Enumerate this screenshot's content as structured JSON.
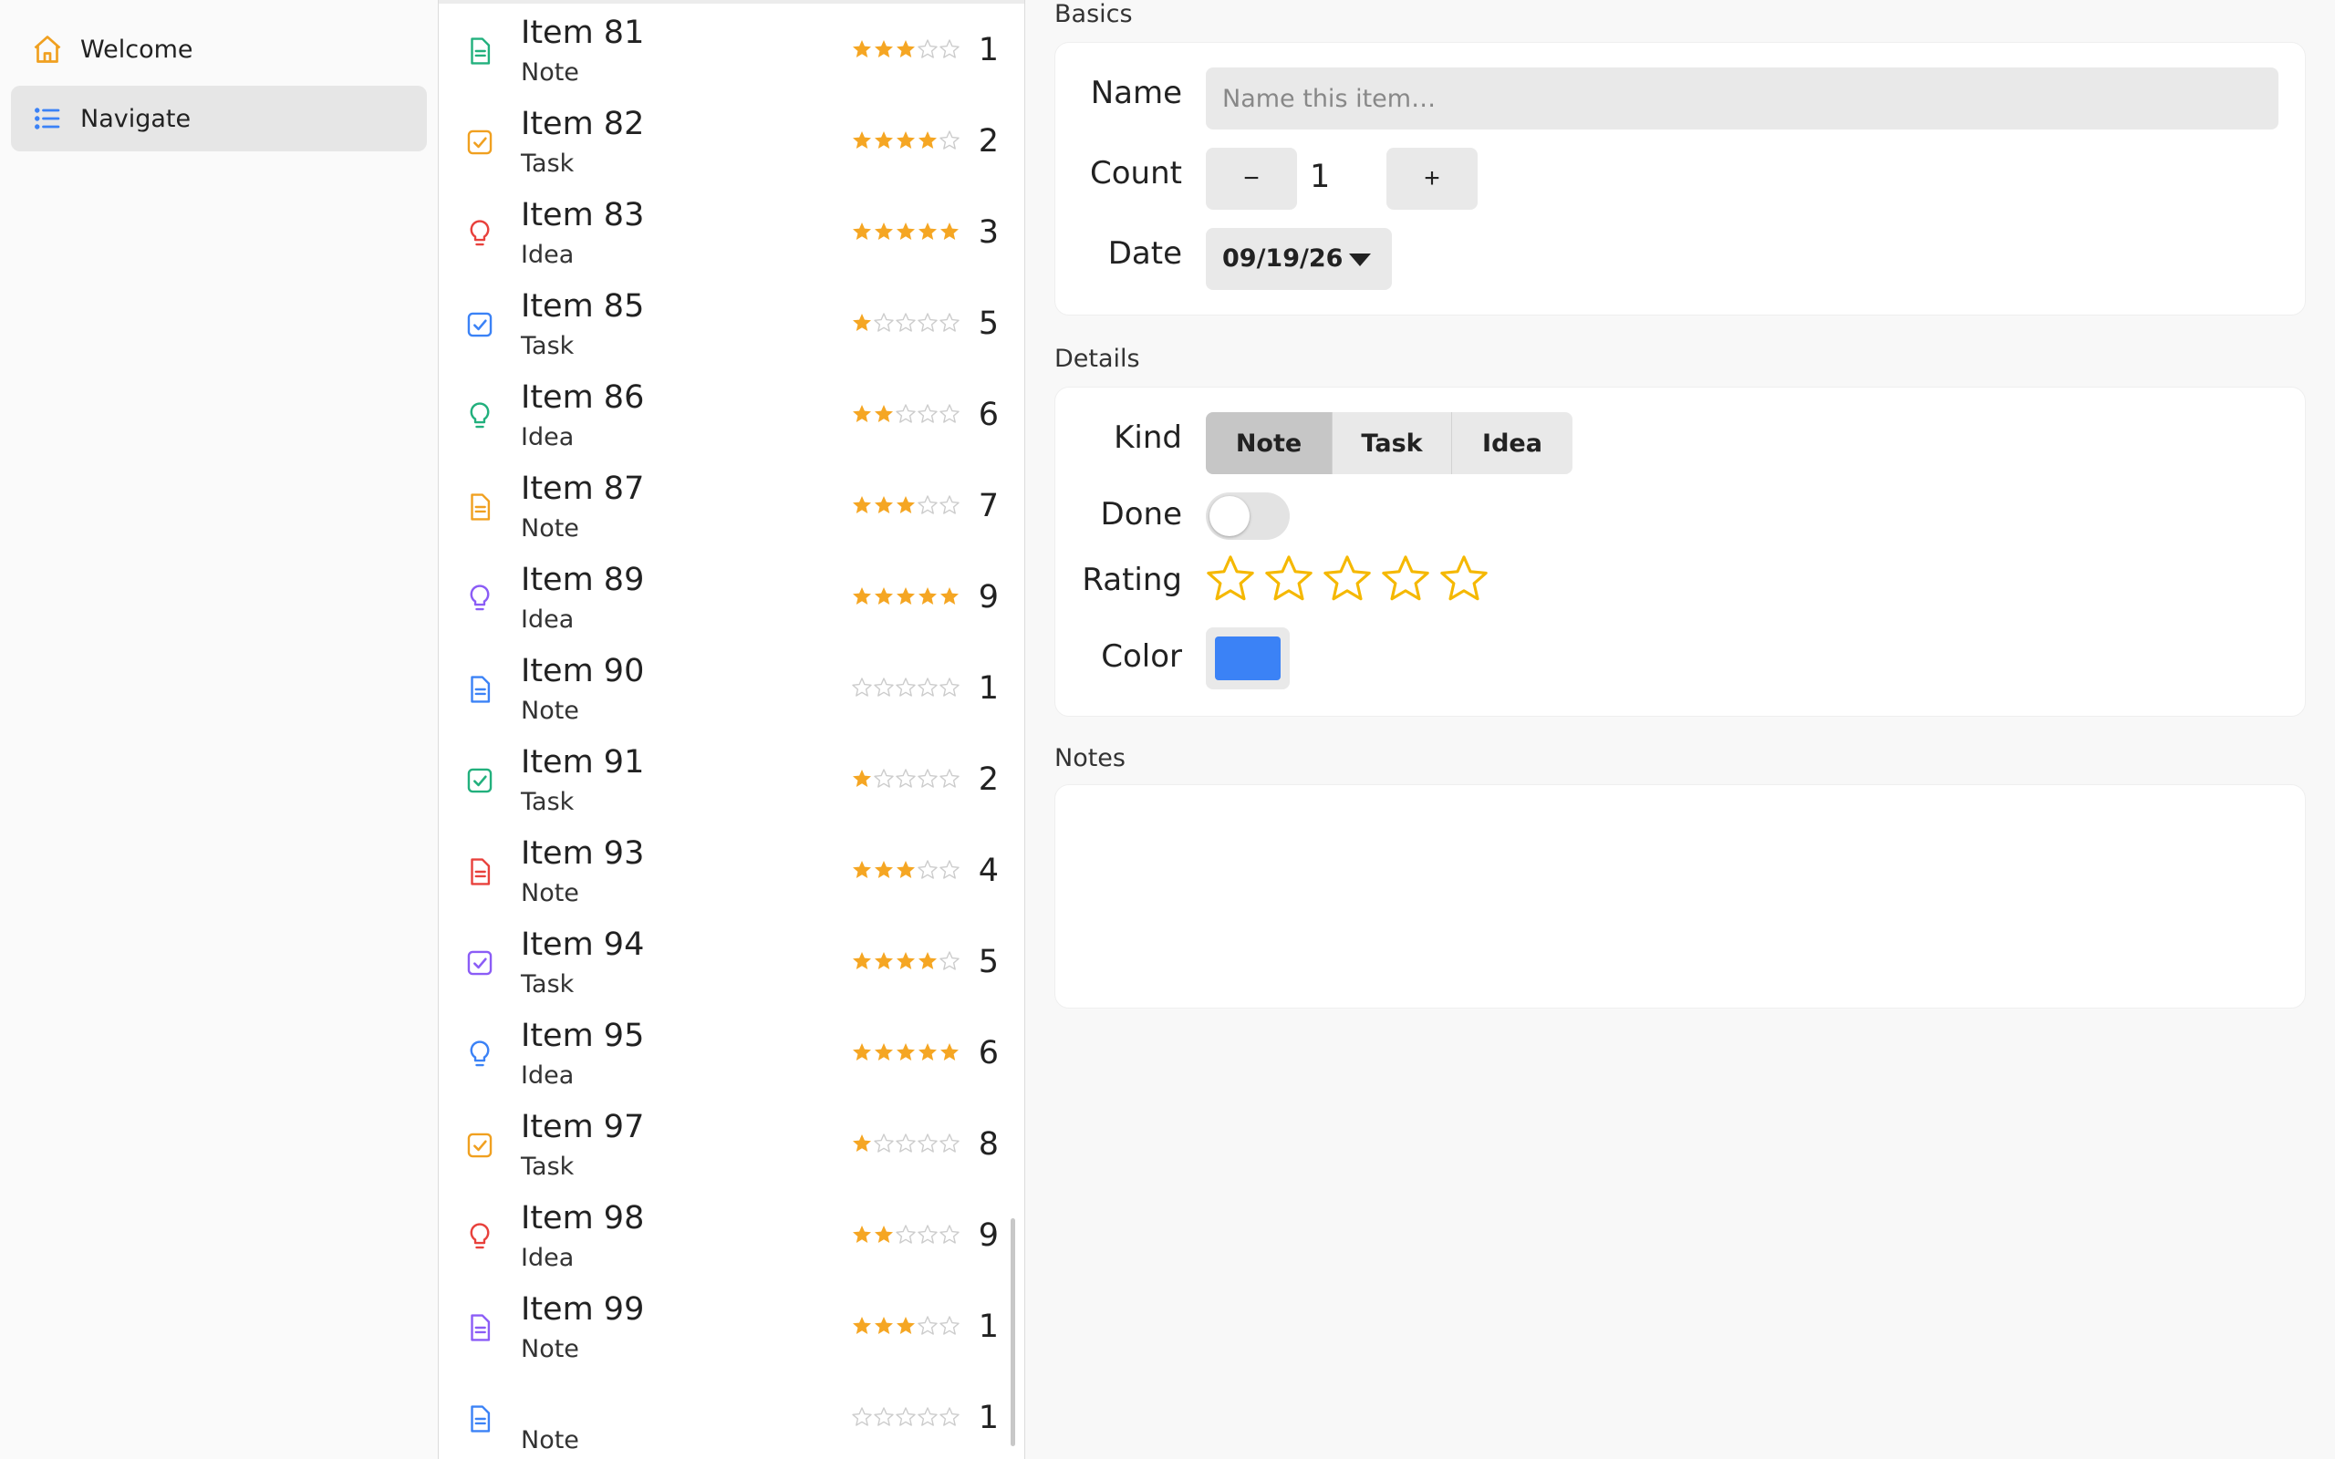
{
  "sidebar": {
    "items": [
      {
        "label": "Welcome",
        "icon": "home-icon",
        "active": false
      },
      {
        "label": "Navigate",
        "icon": "list-icon",
        "active": true
      }
    ]
  },
  "list": {
    "rows": [
      {
        "title": "Item 81",
        "kind": "Note",
        "icon": "note-icon",
        "color": "#22b07d",
        "rating": 3,
        "count": "1"
      },
      {
        "title": "Item 82",
        "kind": "Task",
        "icon": "task-icon",
        "color": "#f0a020",
        "rating": 4,
        "count": "2"
      },
      {
        "title": "Item 83",
        "kind": "Idea",
        "icon": "idea-icon",
        "color": "#e8413c",
        "rating": 5,
        "count": "3"
      },
      {
        "title": "Item 85",
        "kind": "Task",
        "icon": "task-icon",
        "color": "#3b82f6",
        "rating": 1,
        "count": "5"
      },
      {
        "title": "Item 86",
        "kind": "Idea",
        "icon": "idea-icon",
        "color": "#22b07d",
        "rating": 2,
        "count": "6"
      },
      {
        "title": "Item 87",
        "kind": "Note",
        "icon": "note-icon",
        "color": "#f0a020",
        "rating": 3,
        "count": "7"
      },
      {
        "title": "Item 89",
        "kind": "Idea",
        "icon": "idea-icon",
        "color": "#8b5cf6",
        "rating": 5,
        "count": "9"
      },
      {
        "title": "Item 90",
        "kind": "Note",
        "icon": "note-icon",
        "color": "#3b82f6",
        "rating": 0,
        "count": "1"
      },
      {
        "title": "Item 91",
        "kind": "Task",
        "icon": "task-icon",
        "color": "#22b07d",
        "rating": 1,
        "count": "2"
      },
      {
        "title": "Item 93",
        "kind": "Note",
        "icon": "note-icon",
        "color": "#e8413c",
        "rating": 3,
        "count": "4"
      },
      {
        "title": "Item 94",
        "kind": "Task",
        "icon": "task-icon",
        "color": "#8b5cf6",
        "rating": 4,
        "count": "5"
      },
      {
        "title": "Item 95",
        "kind": "Idea",
        "icon": "idea-icon",
        "color": "#3b82f6",
        "rating": 5,
        "count": "6"
      },
      {
        "title": "Item 97",
        "kind": "Task",
        "icon": "task-icon",
        "color": "#f0a020",
        "rating": 1,
        "count": "8"
      },
      {
        "title": "Item 98",
        "kind": "Idea",
        "icon": "idea-icon",
        "color": "#e8413c",
        "rating": 2,
        "count": "9"
      },
      {
        "title": "Item 99",
        "kind": "Note",
        "icon": "note-icon",
        "color": "#8b5cf6",
        "rating": 3,
        "count": "1"
      },
      {
        "title": "",
        "kind": "Note",
        "icon": "note-icon",
        "color": "#3b82f6",
        "rating": 0,
        "count": "1"
      }
    ],
    "star_color": "#f5a623",
    "star_empty_color": "#cccccc"
  },
  "detail": {
    "basics": {
      "section_title": "Basics",
      "name_label": "Name",
      "name_placeholder": "Name this item…",
      "name_value": "",
      "count_label": "Count",
      "decrement_label": "−",
      "increment_label": "+",
      "count_value": "1",
      "date_label": "Date",
      "date_value": "09/19/26"
    },
    "details": {
      "section_title": "Details",
      "kind_label": "Kind",
      "kind_options": [
        "Note",
        "Task",
        "Idea"
      ],
      "kind_selected": "Note",
      "done_label": "Done",
      "done_value": false,
      "rating_label": "Rating",
      "rating_value": 0,
      "rating_max": 5,
      "rating_color": "#f5b800",
      "color_label": "Color",
      "color_value": "#3b82f6"
    },
    "notes": {
      "section_title": "Notes",
      "value": ""
    }
  }
}
